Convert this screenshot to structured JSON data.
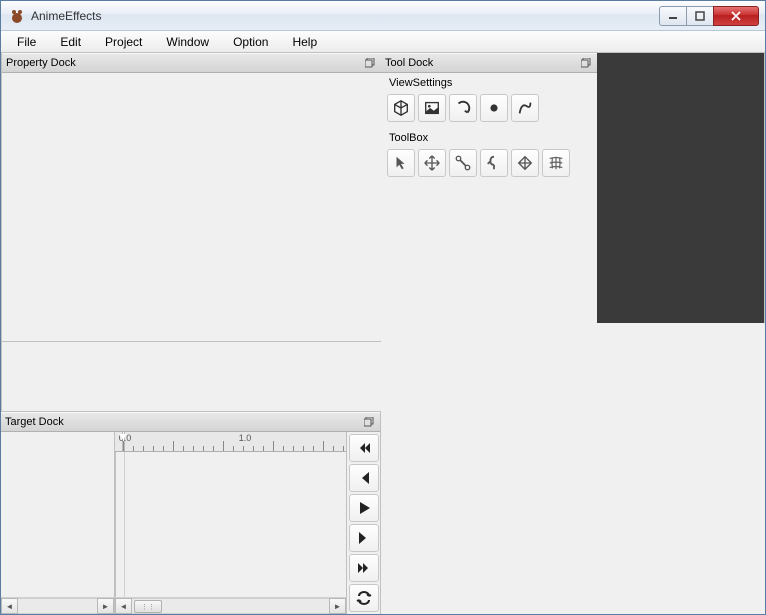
{
  "window": {
    "title": "AnimeEffects"
  },
  "menu": {
    "file": "File",
    "edit": "Edit",
    "project": "Project",
    "window": "Window",
    "option": "Option",
    "help": "Help"
  },
  "docks": {
    "tool": {
      "title": "Tool Dock"
    },
    "property": {
      "title": "Property Dock"
    },
    "target": {
      "title": "Target Dock"
    }
  },
  "sections": {
    "viewsettings": "ViewSettings",
    "toolbox": "ToolBox"
  },
  "timeline": {
    "ticks": [
      "0.0",
      "1.0"
    ]
  },
  "icons": {
    "viewsettings": [
      "cube-icon",
      "image-icon",
      "rotate-icon",
      "dot-icon",
      "curve-icon"
    ],
    "toolbox": [
      "cursor-icon",
      "move-icon",
      "bone-icon",
      "pose-icon",
      "mesh-sharp-icon",
      "mesh-grid-icon"
    ],
    "playback": [
      "goto-start-icon",
      "step-back-icon",
      "play-icon",
      "step-forward-icon",
      "goto-end-icon",
      "loop-icon"
    ]
  }
}
